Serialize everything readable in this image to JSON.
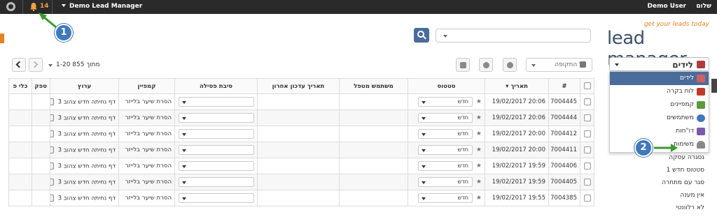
{
  "topbar": {
    "notification_count": "14",
    "app_name": "Demo Lead Manager",
    "user_name": "Demo User",
    "greeting": "שלום"
  },
  "logo": {
    "tagline": "get your leads today",
    "name": "lead manager"
  },
  "search": {
    "placeholder": ""
  },
  "sidebar": {
    "selected": "לידים",
    "menu": [
      {
        "label": "לידים",
        "icon": "leads-icon",
        "color": "#b23a3a"
      },
      {
        "label": "לוח בקרה",
        "icon": "home-icon",
        "color": "#c0392b"
      },
      {
        "label": "קמפיינים",
        "icon": "folder-icon",
        "color": "#5a9a3a"
      },
      {
        "label": "משתמשים",
        "icon": "users-icon",
        "color": "#3f78bd"
      },
      {
        "label": "דו\"חות",
        "icon": "chart-icon",
        "color": "#7a5aa8"
      },
      {
        "label": "משימות",
        "icon": "bell-icon",
        "color": "#777777"
      }
    ],
    "statuses": [
      "נסגרה עסקה",
      "סטטוס חדש 1",
      "סגר עם מתחרה",
      "אין מענה",
      "לא רלוונטי"
    ]
  },
  "toolbar": {
    "pager_text": "1-20 מתוך 855",
    "period_label": "כל התקופה"
  },
  "table": {
    "headers": [
      "#",
      "תאריך",
      "סטטוס",
      "משתמש מטפל",
      "תאריך עדכון אחרון",
      "סיבת פסילה",
      "קמפיין",
      "ערוץ",
      "ספק",
      "כלי פ"
    ],
    "rows": [
      {
        "id": "7004445",
        "date": "19/02/2017 20:06",
        "status": "חדש",
        "campaign": "הסרת שיער בלייזר",
        "channel": "דף נחיתה חדש צהוב 3"
      },
      {
        "id": "7004444",
        "date": "19/02/2017 20:06",
        "status": "חדש",
        "campaign": "הסרת שיער בלייזר",
        "channel": "דף נחיתה חדש צהוב 3"
      },
      {
        "id": "7004412",
        "date": "19/02/2017 20:00",
        "status": "חדש",
        "campaign": "הסרת שיער בלייזר",
        "channel": "דף נחיתה חדש צהוב 3"
      },
      {
        "id": "7004411",
        "date": "19/02/2017 20:00",
        "status": "חדש",
        "campaign": "הסרת שיער בלייזר",
        "channel": "דף נחיתה חדש צהוב 3"
      },
      {
        "id": "7004406",
        "date": "19/02/2017 19:59",
        "status": "חדש",
        "campaign": "הסרת שיער בלייזר",
        "channel": "דף נחיתה חדש צהוב 3"
      },
      {
        "id": "7004405",
        "date": "19/02/2017 19:59",
        "status": "חדש",
        "campaign": "הסרת שיער בלייזר",
        "channel": "דף נחיתה חדש צהוב 3"
      },
      {
        "id": "7004385",
        "date": "19/02/2017 19:55",
        "status": "חדש",
        "campaign": "הסרת שיער בלייזר",
        "channel": "דף נחיתה חדש צהוב 3"
      }
    ]
  },
  "callouts": [
    "1",
    "2"
  ],
  "colors": {
    "topbar": "#2a2a2a",
    "accent": "#4a6c9b",
    "callout": "#3f78bd",
    "arrow": "#3a9a2a",
    "brand_orange": "#e8821e"
  }
}
